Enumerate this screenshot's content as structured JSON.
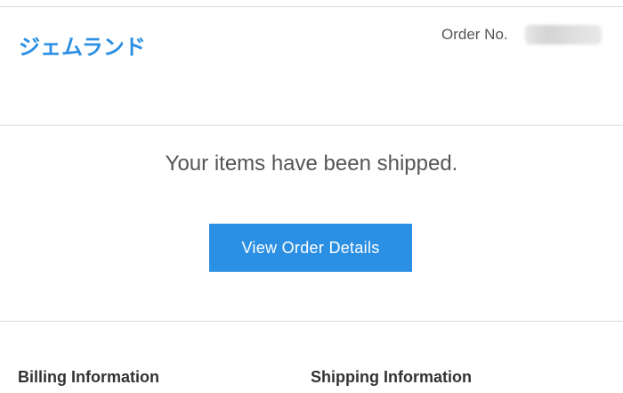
{
  "header": {
    "brand_name": "ジェムランド",
    "order_label": "Order No.",
    "order_number_redacted": true
  },
  "main": {
    "message": "Your items have been shipped.",
    "view_order_button_label": "View Order Details"
  },
  "info": {
    "billing_heading": "Billing Information",
    "shipping_heading": "Shipping Information"
  },
  "colors": {
    "brand": "#2b8fe3",
    "button_bg": "#2b8fe3",
    "button_text": "#ffffff",
    "body_text": "#555555",
    "heading_text": "#333333",
    "divider": "#d9d9d9"
  }
}
